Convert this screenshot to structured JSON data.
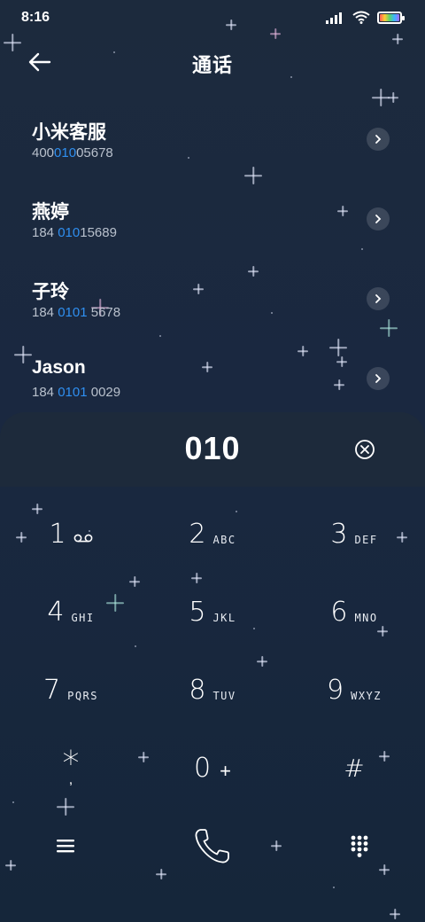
{
  "status_bar": {
    "time": "8:16",
    "icons": [
      "signal-icon",
      "wifi-icon",
      "battery-icon"
    ]
  },
  "header": {
    "title": "通话",
    "back_icon": "arrow-left-icon"
  },
  "contacts": [
    {
      "name": "小米客服",
      "number_pre": "400",
      "number_hl": "010",
      "number_post": "05678"
    },
    {
      "name": "燕婷",
      "number_pre": "184 ",
      "number_hl": "010",
      "number_post": "15689"
    },
    {
      "name": "子玲",
      "number_pre": "184 ",
      "number_hl": "0101",
      "number_post": " 5678"
    },
    {
      "name": "Jason",
      "number_pre": "184 ",
      "number_hl": "0101",
      "number_post": " 0029"
    }
  ],
  "dialer": {
    "input": "010",
    "clear_icon": "clear-circle-icon"
  },
  "keypad": [
    {
      "digit": "1",
      "letters": "",
      "icon": "voicemail-icon"
    },
    {
      "digit": "2",
      "letters": "ABC"
    },
    {
      "digit": "3",
      "letters": "DEF"
    },
    {
      "digit": "4",
      "letters": "GHI"
    },
    {
      "digit": "5",
      "letters": "JKL"
    },
    {
      "digit": "6",
      "letters": "MNO"
    },
    {
      "digit": "7",
      "letters": "PQRS"
    },
    {
      "digit": "8",
      "letters": "TUV"
    },
    {
      "digit": "9",
      "letters": "WXYZ"
    },
    {
      "digit": "*",
      "letters": ","
    },
    {
      "digit": "0",
      "letters": "+"
    },
    {
      "digit": "#",
      "letters": ""
    }
  ],
  "bottom_bar": {
    "icons": [
      "menu-icon",
      "phone-call-icon",
      "dialpad-icon"
    ]
  },
  "colors": {
    "highlight": "#2f8ff0",
    "background": "#1b2a3e"
  }
}
